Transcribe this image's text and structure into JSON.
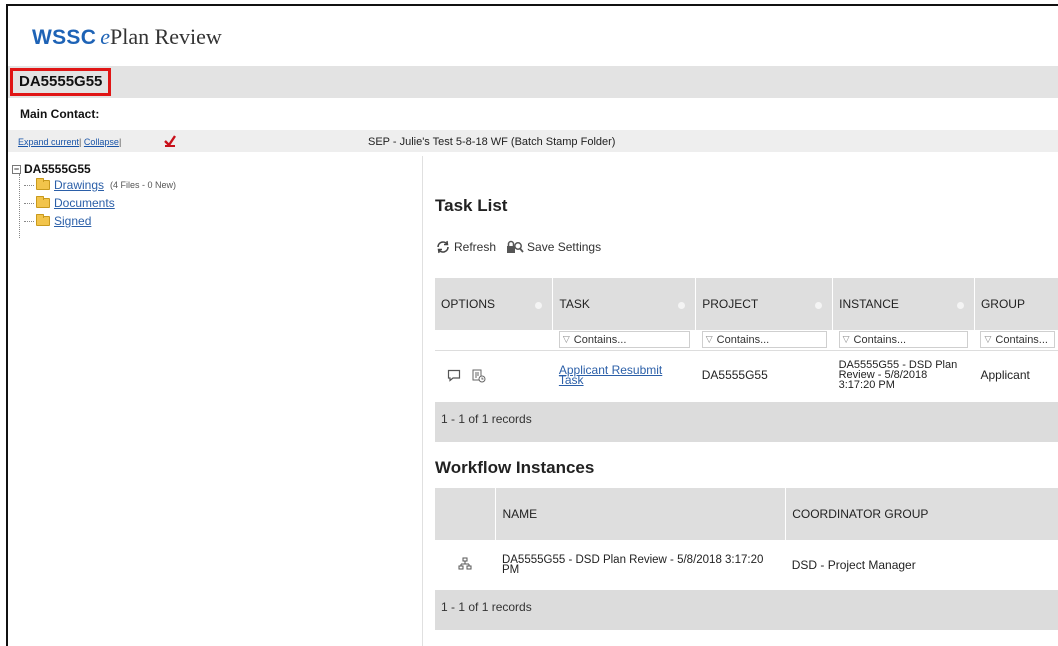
{
  "app": {
    "brand_name": "WSSC",
    "brand_e": "e",
    "brand_rest": "Plan Review",
    "brand_color": "#1e63b6"
  },
  "project": {
    "id": "DA5555G55",
    "highlight_color": "#e01515",
    "main_contact_label": "Main Contact:"
  },
  "toolbar": {
    "expand_label": "Expand current",
    "collapse_label": "Collapse",
    "sep": "|",
    "folder_title": "SEP - Julie's Test 5-8-18 WF (Batch Stamp Folder)"
  },
  "tree": {
    "root": "DA5555G55",
    "items": [
      {
        "label": "Drawings",
        "note": "(4 Files - 0 New)"
      },
      {
        "label": "Documents",
        "note": ""
      },
      {
        "label": "Signed",
        "note": ""
      }
    ]
  },
  "task_list": {
    "title": "Task List",
    "refresh_label": "Refresh",
    "save_settings_label": "Save Settings",
    "columns": [
      "OPTIONS",
      "TASK",
      "PROJECT",
      "INSTANCE",
      "GROUP"
    ],
    "filter_placeholder": "Contains...",
    "rows": [
      {
        "task_line1": "Applicant Resubmit",
        "task_line2": "Task",
        "project": "DA5555G55",
        "instance_line1": "DA5555G55 - DSD Plan",
        "instance_line2": "Review - 5/8/2018",
        "instance_line3": "3:17:20 PM",
        "group": "Applicant"
      }
    ],
    "record_count": "1 - 1 of 1 records"
  },
  "workflow": {
    "title": "Workflow Instances",
    "columns": [
      "NAME",
      "COORDINATOR GROUP"
    ],
    "rows": [
      {
        "name_line1": "DA5555G55 - DSD Plan Review - 5/8/2018 3:17:20",
        "name_line2": "PM",
        "coordinator": "DSD - Project Manager"
      }
    ],
    "record_count": "1 - 1 of 1 records"
  }
}
